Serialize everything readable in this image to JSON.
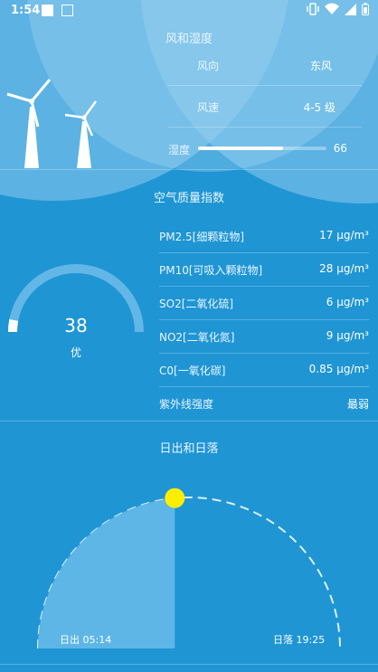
{
  "status_bar": {
    "time": "1:54",
    "icons": [
      "vibrate-icon",
      "wifi-icon",
      "signal-icon",
      "battery-icon"
    ]
  },
  "wind": {
    "title": "风和湿度",
    "direction_label": "风向",
    "direction_value": "东风",
    "speed_label": "风速",
    "speed_value": "4-5 级",
    "humidity_label": "湿度",
    "humidity_value": "66",
    "humidity_fraction": 0.66
  },
  "aqi": {
    "title": "空气质量指数",
    "value": "38",
    "level": "优",
    "gauge_fraction": 0.06,
    "rows": [
      {
        "label": "PM2.5[细颗粒物]",
        "value": "17 μg/m³"
      },
      {
        "label": "PM10[可吸入颗粒物]",
        "value": "28 μg/m³"
      },
      {
        "label": "SO2[二氧化硫]",
        "value": "6 μg/m³"
      },
      {
        "label": "NO2[二氧化氮]",
        "value": "9 μg/m³"
      },
      {
        "label": "C0[一氧化碳]",
        "value": "0.85 μg/m³"
      },
      {
        "label": "紫外线强度",
        "value": "最弱"
      }
    ]
  },
  "sun": {
    "title": "日出和日落",
    "sunrise": "日出 05:14",
    "sunset": "日落 19:25",
    "day_fraction": 0.47
  },
  "colors": {
    "background": "#1f95d4",
    "sun": "#ffee00",
    "track": "#63b7e6"
  }
}
